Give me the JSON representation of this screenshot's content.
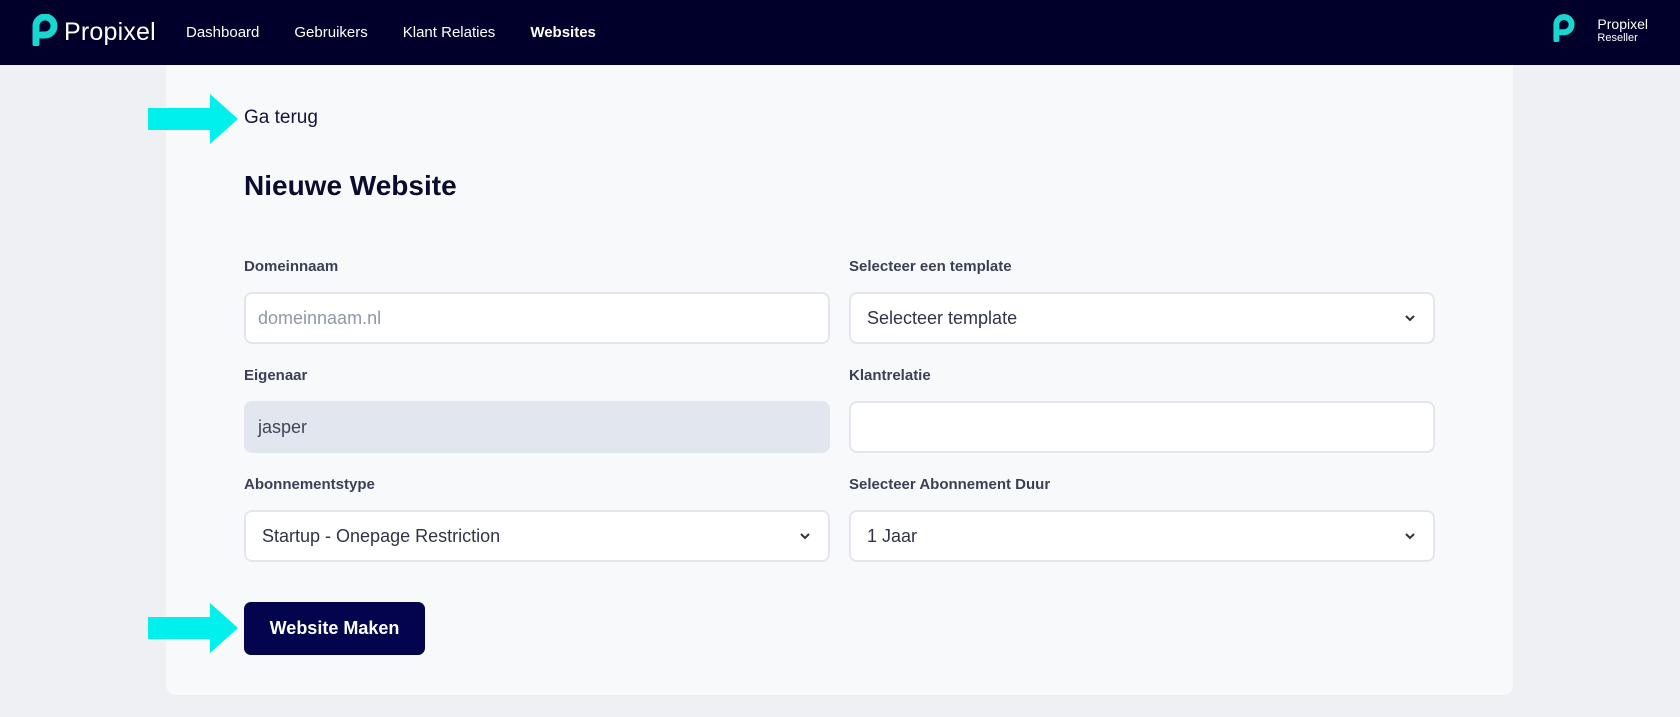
{
  "brand": {
    "name": "Propixel",
    "logo_icon": "propixel-logo-icon",
    "accent": "#18d6d0"
  },
  "nav": {
    "items": [
      {
        "label": "Dashboard",
        "active": false
      },
      {
        "label": "Gebruikers",
        "active": false
      },
      {
        "label": "Klant Relaties",
        "active": false
      },
      {
        "label": "Websites",
        "active": true
      }
    ]
  },
  "user": {
    "name": "Propixel",
    "role": "Reseller"
  },
  "page": {
    "back_label": "Ga terug",
    "title": "Nieuwe Website"
  },
  "form": {
    "domain": {
      "label": "Domeinnaam",
      "placeholder": "domeinnaam.nl",
      "value": ""
    },
    "template": {
      "label": "Selecteer een template",
      "value": "Selecteer template"
    },
    "owner": {
      "label": "Eigenaar",
      "value": "jasper"
    },
    "client": {
      "label": "Klantrelatie",
      "value": ""
    },
    "subscription_type": {
      "label": "Abonnementstype",
      "value": "Startup - Onepage Restriction"
    },
    "subscription_duration": {
      "label": "Selecteer Abonnement Duur",
      "value": "1 Jaar"
    },
    "submit_label": "Website Maken"
  },
  "colors": {
    "topbar": "#00002a",
    "arrow": "#00f0ee",
    "button": "#04044e"
  }
}
